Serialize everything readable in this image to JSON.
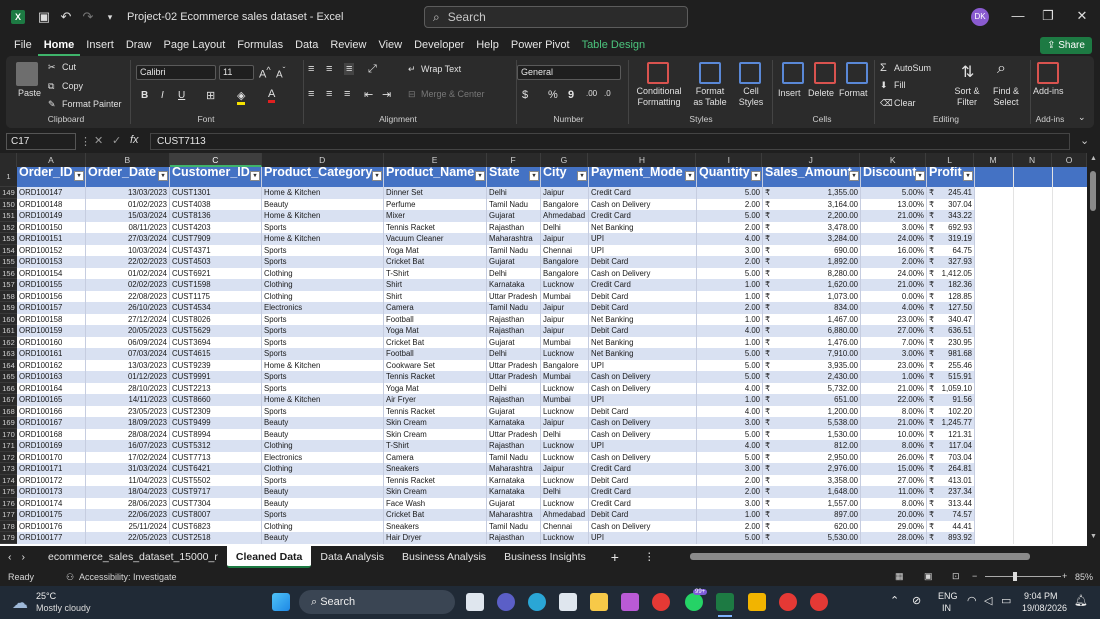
{
  "titlebar": {
    "title": "Project-02 Ecommerce sales dataset  -  Excel",
    "search_placeholder": "Search",
    "avatar": "DK"
  },
  "menu": [
    "File",
    "Home",
    "Insert",
    "Draw",
    "Page Layout",
    "Formulas",
    "Data",
    "Review",
    "View",
    "Developer",
    "Help",
    "Power Pivot",
    "Table Design"
  ],
  "share_label": "Share",
  "ribbon": {
    "clipboard": {
      "paste": "Paste",
      "cut": "Cut",
      "copy": "Copy",
      "format_painter": "Format Painter",
      "label": "Clipboard"
    },
    "font": {
      "name": "Calibri",
      "size": "11",
      "label": "Font",
      "bold": "B",
      "italic": "I",
      "underline": "U"
    },
    "alignment": {
      "wrap": "Wrap Text",
      "merge": "Merge & Center",
      "label": "Alignment"
    },
    "number": {
      "format": "General",
      "label": "Number",
      "currency": "$",
      "percent": "%",
      "comma": "9"
    },
    "styles": {
      "cond": "Conditional Formatting",
      "table": "Format as Table",
      "cell": "Cell Styles",
      "label": "Styles"
    },
    "cells": {
      "insert": "Insert",
      "delete": "Delete",
      "format": "Format",
      "label": "Cells"
    },
    "editing": {
      "autosum": "AutoSum",
      "fill": "Fill",
      "clear": "Clear",
      "sort": "Sort & Filter",
      "find": "Find & Select",
      "label": "Editing"
    },
    "addins": {
      "btn": "Add-ins",
      "label": "Add-ins"
    }
  },
  "formula": {
    "namebox": "C17",
    "fx": "fx",
    "value": "CUST7113"
  },
  "columns": [
    "A",
    "B",
    "C",
    "D",
    "E",
    "F",
    "G",
    "H",
    "I",
    "J",
    "K",
    "L",
    "M",
    "N",
    "O"
  ],
  "headers": [
    "Order_ID",
    "Order_Date",
    "Customer_ID",
    "Product_Category",
    "Product_Name",
    "State",
    "City",
    "Payment_Mode",
    "Quantity",
    "Sales_Amount",
    "Discount",
    "Profit"
  ],
  "rows": [
    [
      "149",
      "ORD100147",
      "13/03/2023",
      "CUST1301",
      "Home & Kitchen",
      "Dinner Set",
      "Delhi",
      "Jaipur",
      "Credit Card",
      "5.00",
      "₹",
      "1,355.00",
      "5.00%",
      "₹",
      "245.41"
    ],
    [
      "150",
      "ORD100148",
      "01/02/2023",
      "CUST4038",
      "Beauty",
      "Perfume",
      "Tamil Nadu",
      "Bangalore",
      "Cash on Delivery",
      "2.00",
      "₹",
      "3,164.00",
      "13.00%",
      "₹",
      "307.04"
    ],
    [
      "151",
      "ORD100149",
      "15/03/2024",
      "CUST8136",
      "Home & Kitchen",
      "Mixer",
      "Gujarat",
      "Ahmedabad",
      "Credit Card",
      "5.00",
      "₹",
      "2,200.00",
      "21.00%",
      "₹",
      "343.22"
    ],
    [
      "152",
      "ORD100150",
      "08/11/2023",
      "CUST4203",
      "Sports",
      "Tennis Racket",
      "Rajasthan",
      "Delhi",
      "Net Banking",
      "2.00",
      "₹",
      "3,478.00",
      "3.00%",
      "₹",
      "692.93"
    ],
    [
      "153",
      "ORD100151",
      "27/03/2024",
      "CUST7909",
      "Home & Kitchen",
      "Vacuum Cleaner",
      "Maharashtra",
      "Jaipur",
      "UPI",
      "4.00",
      "₹",
      "3,284.00",
      "24.00%",
      "₹",
      "319.19"
    ],
    [
      "154",
      "ORD100152",
      "10/03/2024",
      "CUST4371",
      "Sports",
      "Yoga Mat",
      "Tamil Nadu",
      "Chennai",
      "UPI",
      "3.00",
      "₹",
      "690.00",
      "16.00%",
      "₹",
      "64.75"
    ],
    [
      "155",
      "ORD100153",
      "22/02/2023",
      "CUST4503",
      "Sports",
      "Cricket Bat",
      "Gujarat",
      "Bangalore",
      "Debit Card",
      "2.00",
      "₹",
      "1,892.00",
      "2.00%",
      "₹",
      "327.93"
    ],
    [
      "156",
      "ORD100154",
      "01/02/2024",
      "CUST6921",
      "Clothing",
      "T-Shirt",
      "Delhi",
      "Bangalore",
      "Cash on Delivery",
      "5.00",
      "₹",
      "8,280.00",
      "24.00%",
      "₹",
      "1,412.05"
    ],
    [
      "157",
      "ORD100155",
      "02/02/2023",
      "CUST1598",
      "Clothing",
      "Shirt",
      "Karnataka",
      "Lucknow",
      "Credit Card",
      "1.00",
      "₹",
      "1,620.00",
      "21.00%",
      "₹",
      "182.36"
    ],
    [
      "158",
      "ORD100156",
      "22/08/2023",
      "CUST1175",
      "Clothing",
      "Shirt",
      "Uttar Pradesh",
      "Mumbai",
      "Debit Card",
      "1.00",
      "₹",
      "1,073.00",
      "0.00%",
      "₹",
      "128.85"
    ],
    [
      "159",
      "ORD100157",
      "26/10/2023",
      "CUST4534",
      "Electronics",
      "Camera",
      "Tamil Nadu",
      "Jaipur",
      "Debit Card",
      "2.00",
      "₹",
      "834.00",
      "4.00%",
      "₹",
      "127.50"
    ],
    [
      "160",
      "ORD100158",
      "27/12/2024",
      "CUST8026",
      "Sports",
      "Football",
      "Rajasthan",
      "Jaipur",
      "Net Banking",
      "1.00",
      "₹",
      "1,467.00",
      "23.00%",
      "₹",
      "340.47"
    ],
    [
      "161",
      "ORD100159",
      "20/05/2023",
      "CUST5629",
      "Sports",
      "Yoga Mat",
      "Rajasthan",
      "Jaipur",
      "Debit Card",
      "4.00",
      "₹",
      "6,880.00",
      "27.00%",
      "₹",
      "636.51"
    ],
    [
      "162",
      "ORD100160",
      "06/09/2024",
      "CUST3694",
      "Sports",
      "Cricket Bat",
      "Gujarat",
      "Mumbai",
      "Net Banking",
      "1.00",
      "₹",
      "1,476.00",
      "7.00%",
      "₹",
      "230.95"
    ],
    [
      "163",
      "ORD100161",
      "07/03/2024",
      "CUST4615",
      "Sports",
      "Football",
      "Delhi",
      "Lucknow",
      "Net Banking",
      "5.00",
      "₹",
      "7,910.00",
      "3.00%",
      "₹",
      "981.68"
    ],
    [
      "164",
      "ORD100162",
      "13/03/2023",
      "CUST9239",
      "Home & Kitchen",
      "Cookware Set",
      "Uttar Pradesh",
      "Bangalore",
      "UPI",
      "5.00",
      "₹",
      "3,935.00",
      "23.00%",
      "₹",
      "255.46"
    ],
    [
      "165",
      "ORD100163",
      "01/12/2023",
      "CUST9991",
      "Sports",
      "Tennis Racket",
      "Uttar Pradesh",
      "Mumbai",
      "Cash on Delivery",
      "5.00",
      "₹",
      "2,430.00",
      "1.00%",
      "₹",
      "515.91"
    ],
    [
      "166",
      "ORD100164",
      "28/10/2023",
      "CUST2213",
      "Sports",
      "Yoga Mat",
      "Delhi",
      "Lucknow",
      "Cash on Delivery",
      "4.00",
      "₹",
      "5,732.00",
      "21.00%",
      "₹",
      "1,059.10"
    ],
    [
      "167",
      "ORD100165",
      "14/11/2023",
      "CUST8660",
      "Home & Kitchen",
      "Air Fryer",
      "Rajasthan",
      "Mumbai",
      "UPI",
      "1.00",
      "₹",
      "651.00",
      "22.00%",
      "₹",
      "91.56"
    ],
    [
      "168",
      "ORD100166",
      "23/05/2023",
      "CUST2309",
      "Sports",
      "Tennis Racket",
      "Gujarat",
      "Lucknow",
      "Debit Card",
      "4.00",
      "₹",
      "1,200.00",
      "8.00%",
      "₹",
      "102.20"
    ],
    [
      "169",
      "ORD100167",
      "18/09/2023",
      "CUST9499",
      "Beauty",
      "Skin Cream",
      "Karnataka",
      "Jaipur",
      "Cash on Delivery",
      "3.00",
      "₹",
      "5,538.00",
      "21.00%",
      "₹",
      "1,245.77"
    ],
    [
      "170",
      "ORD100168",
      "28/08/2024",
      "CUST8994",
      "Beauty",
      "Skin Cream",
      "Uttar Pradesh",
      "Delhi",
      "Cash on Delivery",
      "5.00",
      "₹",
      "1,530.00",
      "10.00%",
      "₹",
      "121.31"
    ],
    [
      "171",
      "ORD100169",
      "16/07/2023",
      "CUST5312",
      "Clothing",
      "T-Shirt",
      "Rajasthan",
      "Lucknow",
      "UPI",
      "4.00",
      "₹",
      "812.00",
      "8.00%",
      "₹",
      "117.04"
    ],
    [
      "172",
      "ORD100170",
      "17/02/2024",
      "CUST7713",
      "Electronics",
      "Camera",
      "Tamil Nadu",
      "Lucknow",
      "Cash on Delivery",
      "5.00",
      "₹",
      "2,950.00",
      "26.00%",
      "₹",
      "703.04"
    ],
    [
      "173",
      "ORD100171",
      "31/03/2024",
      "CUST6421",
      "Clothing",
      "Sneakers",
      "Maharashtra",
      "Jaipur",
      "Credit Card",
      "3.00",
      "₹",
      "2,976.00",
      "15.00%",
      "₹",
      "264.81"
    ],
    [
      "174",
      "ORD100172",
      "11/04/2023",
      "CUST5502",
      "Sports",
      "Tennis Racket",
      "Karnataka",
      "Lucknow",
      "Debit Card",
      "2.00",
      "₹",
      "3,358.00",
      "27.00%",
      "₹",
      "413.01"
    ],
    [
      "175",
      "ORD100173",
      "18/04/2023",
      "CUST9717",
      "Beauty",
      "Skin Cream",
      "Karnataka",
      "Delhi",
      "Credit Card",
      "2.00",
      "₹",
      "1,648.00",
      "11.00%",
      "₹",
      "237.34"
    ],
    [
      "176",
      "ORD100174",
      "28/06/2023",
      "CUST7304",
      "Beauty",
      "Face Wash",
      "Gujarat",
      "Lucknow",
      "Credit Card",
      "3.00",
      "₹",
      "1,557.00",
      "8.00%",
      "₹",
      "313.44"
    ],
    [
      "177",
      "ORD100175",
      "22/06/2023",
      "CUST8007",
      "Sports",
      "Cricket Bat",
      "Maharashtra",
      "Ahmedabad",
      "Debit Card",
      "1.00",
      "₹",
      "897.00",
      "20.00%",
      "₹",
      "74.57"
    ],
    [
      "178",
      "ORD100176",
      "25/11/2024",
      "CUST6823",
      "Clothing",
      "Sneakers",
      "Tamil Nadu",
      "Chennai",
      "Cash on Delivery",
      "2.00",
      "₹",
      "620.00",
      "29.00%",
      "₹",
      "44.41"
    ],
    [
      "179",
      "ORD100177",
      "22/05/2023",
      "CUST2518",
      "Beauty",
      "Hair Dryer",
      "Rajasthan",
      "Lucknow",
      "UPI",
      "5.00",
      "₹",
      "5,530.00",
      "28.00%",
      "₹",
      "893.92"
    ]
  ],
  "sheets": [
    "ecommerce_sales_dataset_15000_r",
    "Cleaned Data",
    "Data Analysis",
    "Business Analysis",
    "Business Insights"
  ],
  "status": {
    "ready": "Ready",
    "accessibility": "Accessibility: Investigate",
    "zoom": "85%"
  },
  "taskbar": {
    "temp": "25°C",
    "weather": "Mostly cloudy",
    "search": "Search",
    "lang1": "ENG",
    "lang2": "IN",
    "time": "9:04 PM",
    "date": "19/08/2026",
    "badge": "99+"
  },
  "colors": {
    "accent": "#1d7a43",
    "header": "#4472c4",
    "band": "#d9e1f2"
  }
}
